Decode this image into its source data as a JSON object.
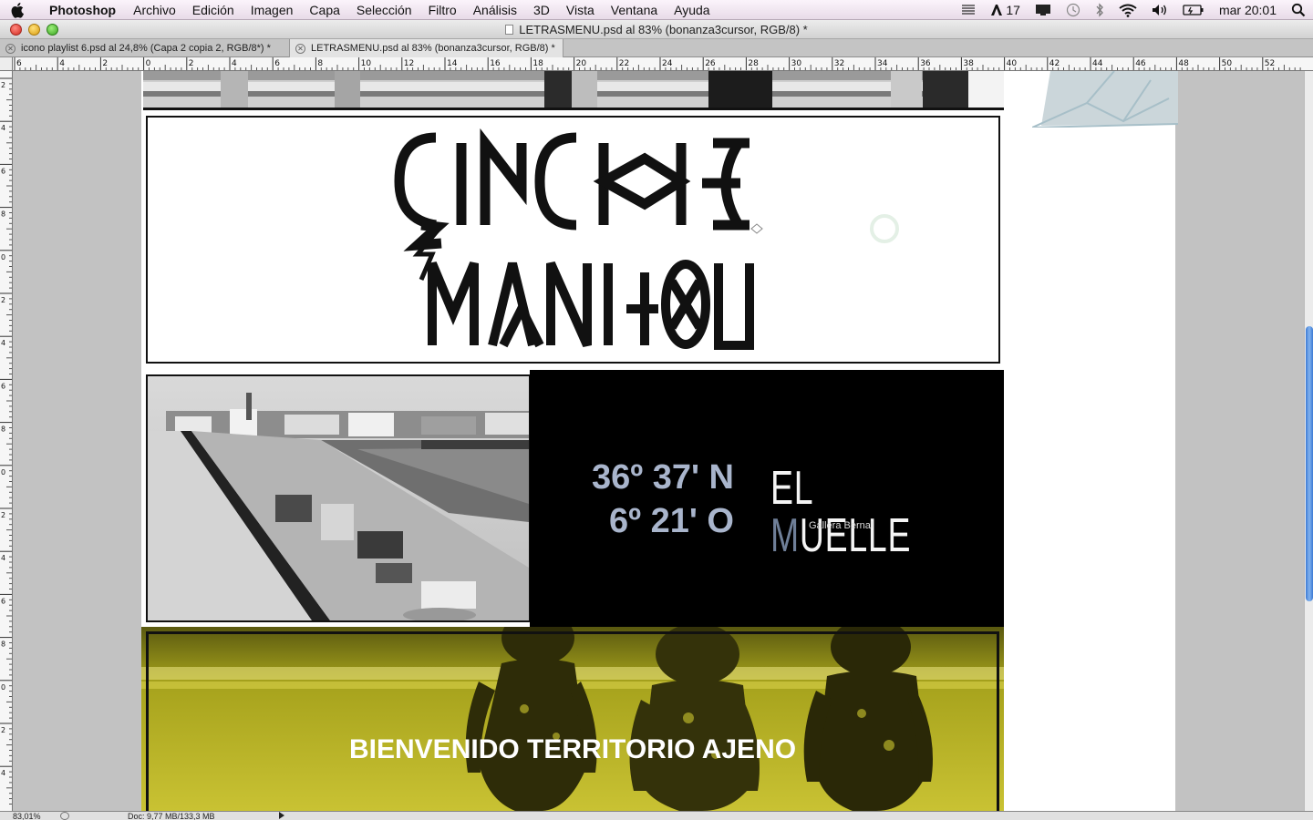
{
  "menubar": {
    "app_name": "Photoshop",
    "items": [
      "Archivo",
      "Edición",
      "Imagen",
      "Capa",
      "Selección",
      "Filtro",
      "Análisis",
      "3D",
      "Vista",
      "Ventana",
      "Ayuda"
    ],
    "adobe_count": "17",
    "clock": "mar 20:01"
  },
  "window": {
    "title": "LETRASMENU.psd al 83% (bonanza3cursor, RGB/8) *"
  },
  "tabs": [
    {
      "label": "icono playlist 6.psd al 24,8% (Capa 2 copia 2, RGB/8*) *",
      "active": false
    },
    {
      "label": "LETRASMENU.psd al 83% (bonanza3cursor, RGB/8) *",
      "active": true
    }
  ],
  "ruler": {
    "top_labels": [
      "6",
      "4",
      "2",
      "0",
      "2",
      "4",
      "6",
      "8",
      "10",
      "12",
      "14",
      "16",
      "18",
      "20",
      "22",
      "24",
      "26",
      "28",
      "30",
      "32",
      "34",
      "36",
      "38",
      "40",
      "42",
      "44",
      "46",
      "48",
      "50",
      "52"
    ],
    "left_labels": [
      "2",
      "4",
      "6",
      "8",
      "0",
      "2",
      "4",
      "6",
      "8",
      "0",
      "2",
      "4",
      "6",
      "8",
      "0",
      "2",
      "4"
    ]
  },
  "design": {
    "logo_line1": "GINCHE",
    "logo_line2": "MANITOU",
    "coords_lat": "36º 37' N",
    "coords_lon": "6º 21' O",
    "muelle_el": "EL ",
    "muelle_m": "M",
    "muelle_rest": "UELLE",
    "muelle_sub": "Gallera Bernal",
    "welcome": "BIENVENIDO TERRITORIO AJENO"
  },
  "status": {
    "zoom": "83,01%",
    "doc": "Doc: 9,77 MB/133,3 MB"
  },
  "colors": {
    "coords_text": "#a9b5cc",
    "yellow_panel": "#6f6d18",
    "scroll_thumb": "#3b79d3"
  }
}
